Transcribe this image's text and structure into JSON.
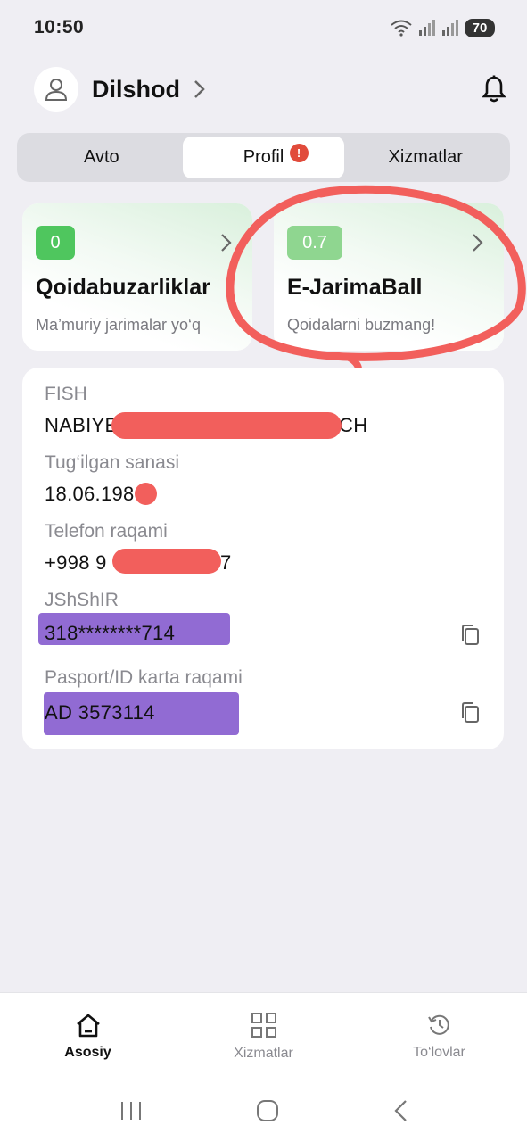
{
  "status_bar": {
    "time": "10:50",
    "battery": "70"
  },
  "header": {
    "user_name": "Dilshod"
  },
  "tabs": [
    {
      "label": "Avto",
      "active": false
    },
    {
      "label": "Profil",
      "active": true,
      "badge": "!"
    },
    {
      "label": "Xizmatlar",
      "active": false
    }
  ],
  "cards": [
    {
      "value": "0",
      "title": "Qoidabuzarliklar",
      "subtitle": "Ma’muriy jarimalar yo‘q",
      "badge_color": "#4fc65e"
    },
    {
      "value": "0.7",
      "title": "E-JarimaBall",
      "subtitle": "Qoidalarni buzmang!",
      "badge_color": "#8fd690"
    }
  ],
  "profile": {
    "fish": {
      "label": "FISH",
      "value_start": "NABIYE",
      "value_end": "CH"
    },
    "birth": {
      "label": "Tug‘ilgan sanasi",
      "value": "18.06.198"
    },
    "phone": {
      "label": "Telefon raqami",
      "value_start": "+998 9",
      "value_end": "7"
    },
    "jshshir": {
      "label": "JShShIR",
      "value": "318********714"
    },
    "passport": {
      "label": "Pasport/ID karta raqami",
      "value": "AD 3573114"
    }
  },
  "bottom_nav": [
    {
      "label": "Asosiy",
      "icon": "home-icon",
      "active": true
    },
    {
      "label": "Xizmatlar",
      "icon": "grid-icon",
      "active": false
    },
    {
      "label": "To‘lovlar",
      "icon": "history-icon",
      "active": false
    }
  ],
  "colors": {
    "accent_green": "#4fc65e",
    "annotation_red": "#f25f5c",
    "redaction_purple": "#6c3ac4"
  }
}
